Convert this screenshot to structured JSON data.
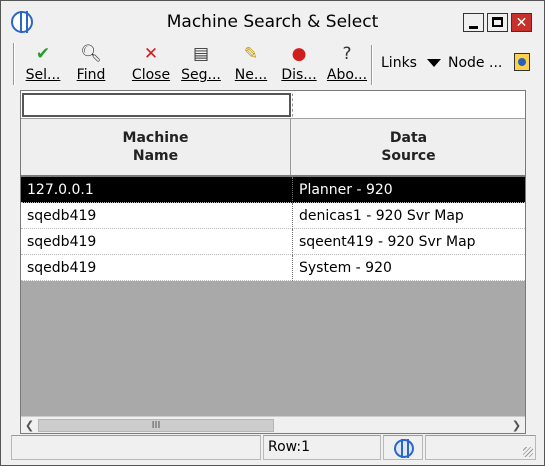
{
  "window": {
    "title": "Machine Search & Select",
    "buttons": {
      "minimize": "minimize",
      "maximize": "maximize",
      "close": "✕"
    }
  },
  "toolbar": {
    "buttons": [
      {
        "label": "Sel...",
        "icon": "select-checkmark-icon"
      },
      {
        "label": "Find",
        "icon": "find-magnifier-icon"
      },
      {
        "label": "Close",
        "icon": "close-x-icon"
      },
      {
        "label": "Seg...",
        "icon": "segment-document-icon"
      },
      {
        "label": "Ne...",
        "icon": "new-icon"
      },
      {
        "label": "Dis...",
        "icon": "display-icon"
      },
      {
        "label": "Abo...",
        "icon": "about-help-icon"
      }
    ],
    "links_label": "Links",
    "node_label": "Node ..."
  },
  "grid": {
    "columns": [
      {
        "line1": "Machine",
        "line2": "Name"
      },
      {
        "line1": "Data",
        "line2": "Source"
      }
    ],
    "rows": [
      {
        "machine": "127.0.0.1",
        "source": "Planner - 920",
        "selected": true
      },
      {
        "machine": "sqedb419",
        "source": "denicas1 - 920 Svr Map",
        "selected": false
      },
      {
        "machine": "sqedb419",
        "source": "sqeent419 - 920 Svr Map",
        "selected": false
      },
      {
        "machine": "sqedb419",
        "source": "System - 920",
        "selected": false
      }
    ],
    "scroll_thumb_label": "III"
  },
  "status": {
    "row_label": "Row:1"
  }
}
